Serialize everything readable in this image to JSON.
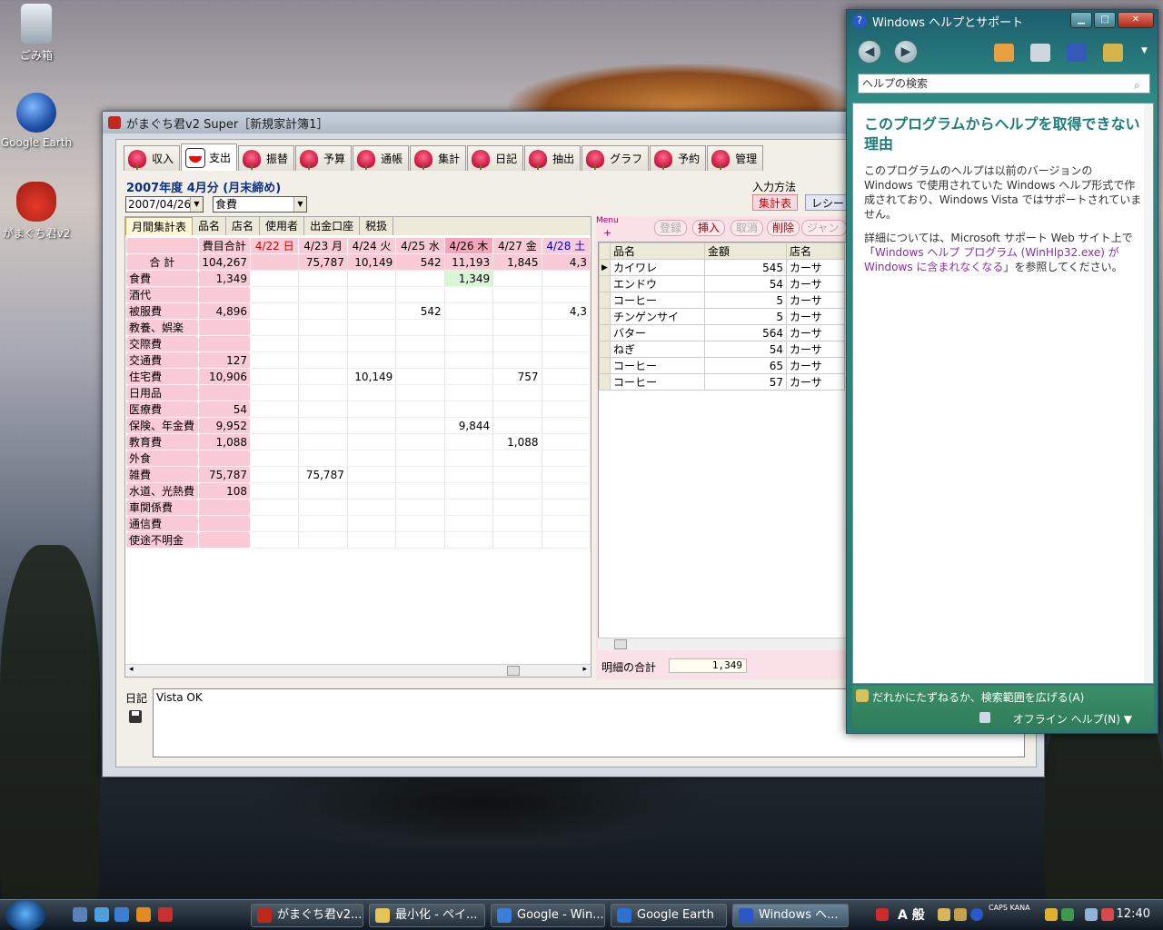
{
  "desktop": {
    "icons": [
      {
        "label": "ごみ箱",
        "icon": "recycle-bin-icon"
      },
      {
        "label": "Google Earth",
        "icon": "google-earth-icon"
      },
      {
        "label": "がまぐち君v2",
        "icon": "purse-icon"
      }
    ]
  },
  "app": {
    "title": "がまぐち君v2 Super［新規家計簿1］",
    "tabs": [
      "収入",
      "支出",
      "振替",
      "予算",
      "通帳",
      "集計",
      "日記",
      "抽出",
      "グラフ",
      "予約",
      "管理"
    ],
    "active_tab": "支出",
    "period_title": "2007年度 4月分 (月末締め)",
    "date_value": "2007/04/26",
    "category_value": "食費",
    "input_method_label": "入力方法",
    "input_method_options": [
      "集計表",
      "レシート"
    ],
    "subtabs": [
      "月間集計表",
      "品名",
      "店名",
      "使用者",
      "出金口座",
      "税扱"
    ],
    "grid": {
      "header_total": "費目合計",
      "days": [
        "4/22 日",
        "4/23 月",
        "4/24 火",
        "4/25 水",
        "4/26 木",
        "4/27 金",
        "4/28 土"
      ],
      "sum_row": {
        "label": "合 計",
        "total": "104,267",
        "values": [
          "",
          "75,787",
          "10,149",
          "542",
          "11,193",
          "1,845",
          "4,3"
        ]
      },
      "rows": [
        {
          "label": "食費",
          "total": "1,349",
          "values": [
            "",
            "",
            "",
            "",
            "1,349",
            "",
            ""
          ]
        },
        {
          "label": "酒代",
          "total": "",
          "values": [
            "",
            "",
            "",
            "",
            "",
            "",
            ""
          ]
        },
        {
          "label": "被服費",
          "total": "4,896",
          "values": [
            "",
            "",
            "",
            "542",
            "",
            "",
            "4,3"
          ]
        },
        {
          "label": "教養、娯楽",
          "total": "",
          "values": [
            "",
            "",
            "",
            "",
            "",
            "",
            ""
          ]
        },
        {
          "label": "交際費",
          "total": "",
          "values": [
            "",
            "",
            "",
            "",
            "",
            "",
            ""
          ]
        },
        {
          "label": "交通費",
          "total": "127",
          "values": [
            "",
            "",
            "",
            "",
            "",
            "",
            ""
          ]
        },
        {
          "label": "住宅費",
          "total": "10,906",
          "values": [
            "",
            "",
            "10,149",
            "",
            "",
            "757",
            ""
          ]
        },
        {
          "label": "日用品",
          "total": "",
          "values": [
            "",
            "",
            "",
            "",
            "",
            "",
            ""
          ]
        },
        {
          "label": "医療費",
          "total": "54",
          "values": [
            "",
            "",
            "",
            "",
            "",
            "",
            ""
          ]
        },
        {
          "label": "保険、年金費",
          "total": "9,952",
          "values": [
            "",
            "",
            "",
            "",
            "9,844",
            "",
            ""
          ]
        },
        {
          "label": "教育費",
          "total": "1,088",
          "values": [
            "",
            "",
            "",
            "",
            "",
            "1,088",
            ""
          ]
        },
        {
          "label": "外食",
          "total": "",
          "values": [
            "",
            "",
            "",
            "",
            "",
            "",
            ""
          ]
        },
        {
          "label": "雑費",
          "total": "75,787",
          "values": [
            "",
            "75,787",
            "",
            "",
            "",
            "",
            ""
          ]
        },
        {
          "label": "水道、光熱費",
          "total": "108",
          "values": [
            "",
            "",
            "",
            "",
            "",
            "",
            ""
          ]
        },
        {
          "label": "車関係費",
          "total": "",
          "values": [
            "",
            "",
            "",
            "",
            "",
            "",
            ""
          ]
        },
        {
          "label": "通信費",
          "total": "",
          "values": [
            "",
            "",
            "",
            "",
            "",
            "",
            ""
          ]
        },
        {
          "label": "使途不明金",
          "total": "",
          "values": [
            "",
            "",
            "",
            "",
            "",
            "",
            ""
          ]
        }
      ]
    },
    "detail": {
      "menu_label": "Menu",
      "menu_plus": "+",
      "buttons": [
        "登録",
        "挿入",
        "取消",
        "削除",
        "ジャンプ"
      ],
      "columns": [
        "品名",
        "金額",
        "店名"
      ],
      "rows": [
        {
          "name": "カイワレ",
          "amount": "545",
          "shop": "カーサ"
        },
        {
          "name": "エンドウ",
          "amount": "54",
          "shop": "カーサ"
        },
        {
          "name": "コーヒー",
          "amount": "5",
          "shop": "カーサ"
        },
        {
          "name": "チンゲンサイ",
          "amount": "5",
          "shop": "カーサ"
        },
        {
          "name": "バター",
          "amount": "564",
          "shop": "カーサ"
        },
        {
          "name": "ねぎ",
          "amount": "54",
          "shop": "カーサ"
        },
        {
          "name": "コーヒー",
          "amount": "65",
          "shop": "カーサ"
        },
        {
          "name": "コーヒー",
          "amount": "57",
          "shop": "カーサ"
        }
      ],
      "total_label": "明細の合計",
      "total_value": "1,349"
    },
    "diary": {
      "label": "日記",
      "text": "Vista  OK"
    }
  },
  "help": {
    "title": "Windows ヘルプとサポート",
    "search_placeholder": "ヘルプの検索",
    "heading": "このプログラムからヘルプを取得できない理由",
    "para1": "このプログラムのヘルプは以前のバージョンの Windows で使用されていた Windows ヘルプ形式で作成されており、Windows Vista ではサポートされていません。",
    "para2_prefix": "詳細については、Microsoft サポート Web サイト上で「",
    "para2_link": "Windows ヘルプ プログラム (WinHlp32.exe) が Windows に含まれなくなる",
    "para2_suffix": "」を参照してください。",
    "footer_ask": "だれかにたずねるか、検索範囲を広げる(A)",
    "footer_offline": "オフライン ヘルプ(N) ▼"
  },
  "taskbar": {
    "buttons": [
      "がまぐち君v2...",
      "最小化 - ペイ...",
      "Google - Win...",
      "Google Earth",
      "Windows ヘ..."
    ],
    "ime": "A 般",
    "caps": "CAPS KANA",
    "clock": "12:40"
  }
}
